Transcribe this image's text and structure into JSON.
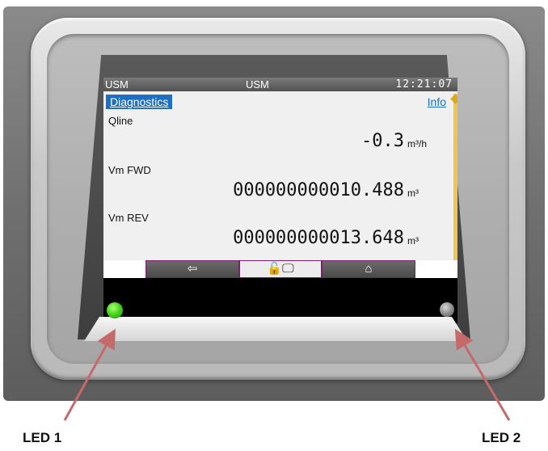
{
  "status_bar": {
    "left": "USM",
    "center": "USM",
    "time": "12:21:07"
  },
  "screen": {
    "title": "Diagnostics",
    "info_link": "Info",
    "rows": [
      {
        "label": "Qline",
        "value": "-0.3",
        "unit": "m³/h"
      },
      {
        "label": "Vm FWD",
        "value": "000000000010.488",
        "unit": "m³"
      },
      {
        "label": "Vm REV",
        "value": "000000000013.648",
        "unit": "m³"
      }
    ]
  },
  "nav": [
    {
      "icon": "back-arrow-icon",
      "glyph": "⇦"
    },
    {
      "icon": "lock-display-icon",
      "glyph": "🔓🖵"
    },
    {
      "icon": "home-icon",
      "glyph": "⌂"
    }
  ],
  "leds": {
    "led1": {
      "label": "LED 1",
      "color": "#46d81d",
      "state": "on"
    },
    "led2": {
      "label": "LED 2",
      "color": "#8c8c8c",
      "state": "off"
    }
  }
}
